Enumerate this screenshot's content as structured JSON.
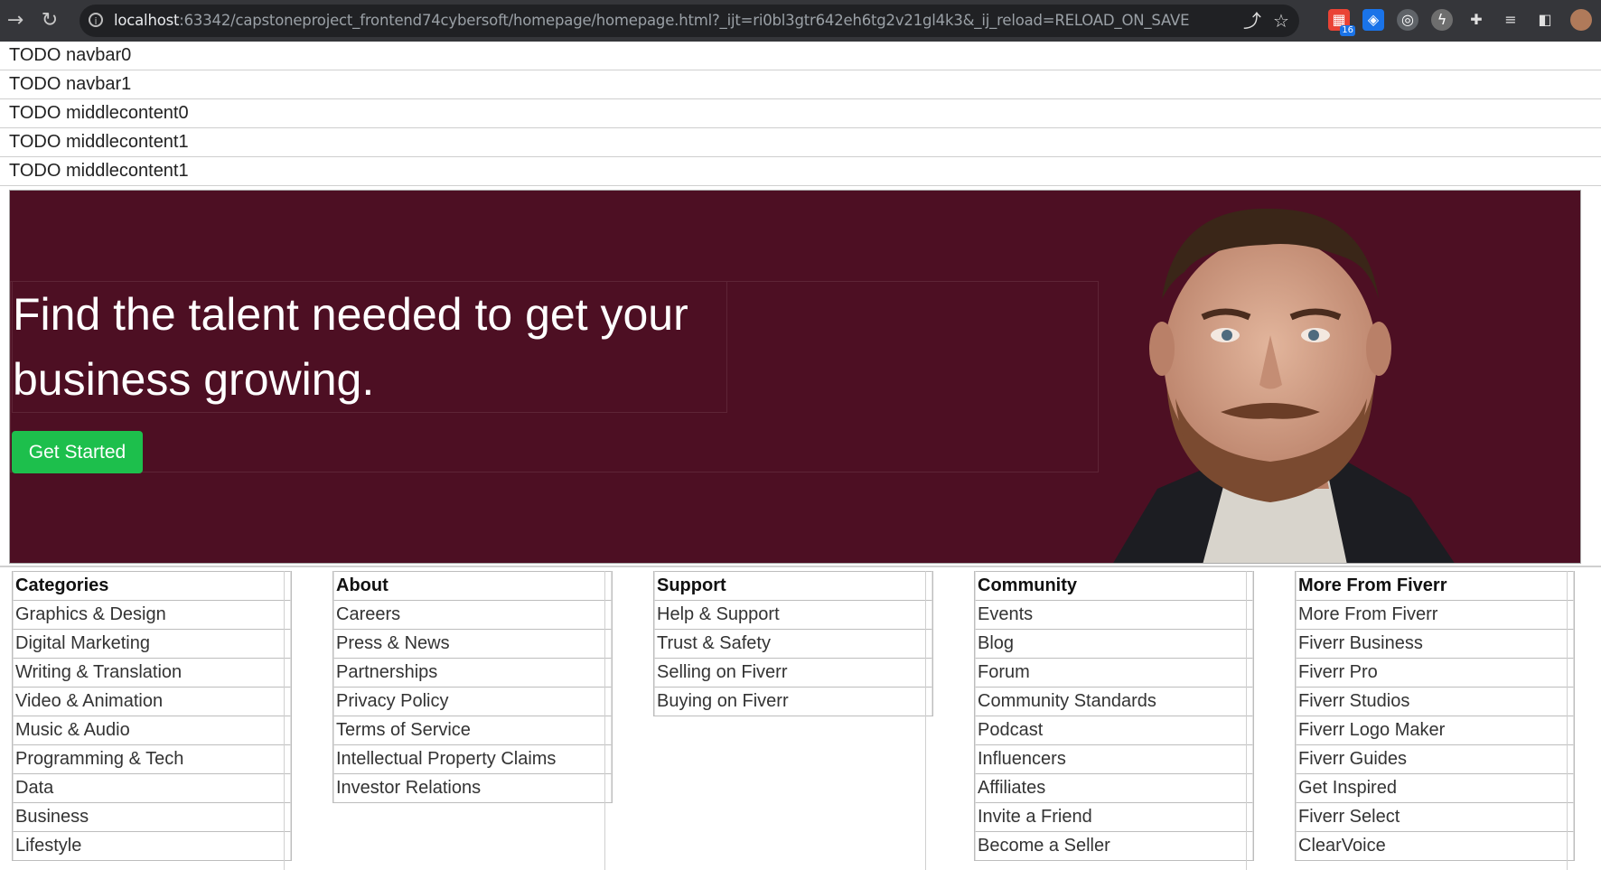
{
  "browser": {
    "url_host": "localhost",
    "url_rest": ":63342/capstoneproject_frontend74cybersoft/homepage/homepage.html?_ijt=ri0bl3gtr642eh6tg2v21gl4k3&_ij_reload=RELOAD_ON_SAVE",
    "ext_badge": "16"
  },
  "todo_rows": [
    "TODO navbar0",
    "TODO navbar1",
    "TODO middlecontent0",
    "TODO middlecontent1",
    "TODO middlecontent1"
  ],
  "hero": {
    "title": "Find the talent needed to get your business growing.",
    "cta": "Get Started",
    "bg_color": "#4d0f23",
    "cta_color": "#1dbf4c"
  },
  "footer": {
    "columns": [
      {
        "heading": "Categories",
        "items": [
          "Graphics & Design",
          "Digital Marketing",
          "Writing & Translation",
          "Video & Animation",
          "Music & Audio",
          "Programming & Tech",
          "Data",
          "Business",
          "Lifestyle"
        ]
      },
      {
        "heading": "About",
        "items": [
          "Careers",
          "Press & News",
          "Partnerships",
          "Privacy Policy",
          "Terms of Service",
          "Intellectual Property Claims",
          "Investor Relations"
        ]
      },
      {
        "heading": "Support",
        "items": [
          "Help & Support",
          "Trust & Safety",
          "Selling on Fiverr",
          "Buying on Fiverr"
        ]
      },
      {
        "heading": "Community",
        "items": [
          "Events",
          "Blog",
          "Forum",
          "Community Standards",
          "Podcast",
          "Influencers",
          "Affiliates",
          "Invite a Friend",
          "Become a Seller"
        ]
      },
      {
        "heading": "More From Fiverr",
        "items": [
          "More From Fiverr",
          "Fiverr Business",
          "Fiverr Pro",
          "Fiverr Studios",
          "Fiverr Logo Maker",
          "Fiverr Guides",
          "Get Inspired",
          "Fiverr Select",
          "ClearVoice"
        ]
      }
    ]
  }
}
